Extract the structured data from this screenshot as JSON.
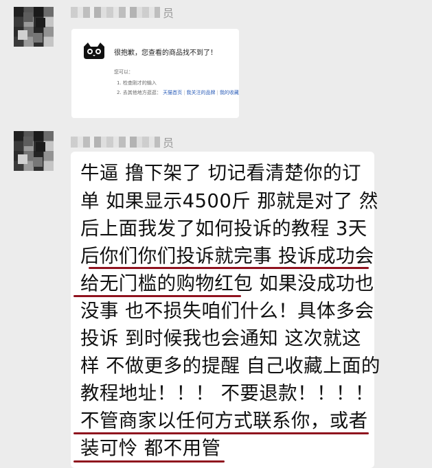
{
  "messages": [
    {
      "sender_role": "员",
      "type": "card",
      "card": {
        "title": "很抱歉，您查看的商品找不到了！",
        "label": "您可以：",
        "items": [
          {
            "number": "1.",
            "text": "检查刚才的输入"
          },
          {
            "number": "2.",
            "text": "去其他地方逛逛：",
            "links": [
              "天猫首页",
              "我关注的品牌",
              "我的收藏"
            ]
          }
        ]
      }
    },
    {
      "sender_role": "员",
      "type": "text",
      "lines": [
        "牛逼 撸下架了 切记看清楚你的订",
        "单 如果显示4500斤 那就是对了 然",
        "后上面我发了如何投诉的教程 3天",
        "后你们你们投诉就完事 投诉成功会",
        "给无门槛的购物红包 如果没成功也",
        "没事 也不损失咱们什么！具体多会",
        "投诉 到时候我也会通知 这次就这",
        "样 不做更多的提醒 自己收藏上面的",
        "教程地址！！！ 不要退款！！！！",
        "不管商家以任何方式联系你，或者",
        "装可怜 都不用管"
      ]
    }
  ],
  "colors": {
    "background": "#ececec",
    "bubble": "#ffffff",
    "underline": "#8f111d",
    "link": "#2a5cb8"
  }
}
